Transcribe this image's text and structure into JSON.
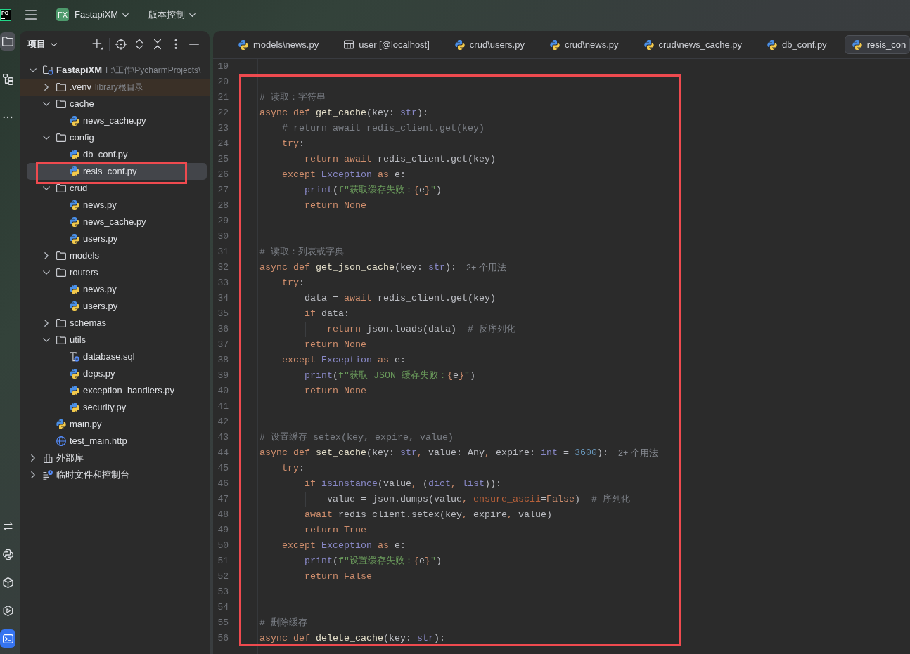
{
  "title_bar": {
    "logo_text": "PC",
    "project_badge": "FX",
    "project_name": "FastapiXM",
    "vcs_menu": "版本控制"
  },
  "tool_strip": {
    "top": [
      {
        "kind": "project",
        "selected": true
      },
      {
        "kind": "structure",
        "selected": false
      },
      {
        "kind": "more",
        "selected": false
      }
    ],
    "bottom": [
      {
        "kind": "commit",
        "selected": false
      },
      {
        "kind": "console",
        "selected": false
      },
      {
        "kind": "packages",
        "selected": false
      },
      {
        "kind": "services",
        "selected": false
      },
      {
        "kind": "terminal",
        "selected": true
      }
    ]
  },
  "project_panel": {
    "title": "项目",
    "tree": [
      {
        "label": "FastapiXM",
        "detail": "F:\\工作\\PycharmProjects\\",
        "kind": "module",
        "expanded": true,
        "selected": false,
        "boxed": false,
        "children": [
          {
            "label": ".venv",
            "detail": "library根目录",
            "kind": "excluded",
            "expanded": false,
            "selected": false,
            "boxed": false
          },
          {
            "label": "cache",
            "kind": "folder",
            "expanded": true,
            "selected": false,
            "boxed": false,
            "children": [
              {
                "label": "news_cache.py",
                "kind": "python",
                "selected": false,
                "boxed": false
              }
            ]
          },
          {
            "label": "config",
            "kind": "folder",
            "expanded": true,
            "selected": false,
            "boxed": false,
            "children": [
              {
                "label": "db_conf.py",
                "kind": "python",
                "selected": false,
                "boxed": false
              },
              {
                "label": "resis_conf.py",
                "kind": "python",
                "selected": true,
                "boxed": true
              }
            ]
          },
          {
            "label": "crud",
            "kind": "folder",
            "expanded": true,
            "selected": false,
            "boxed": false,
            "children": [
              {
                "label": "news.py",
                "kind": "python",
                "selected": false,
                "boxed": false
              },
              {
                "label": "news_cache.py",
                "kind": "python",
                "selected": false,
                "boxed": false
              },
              {
                "label": "users.py",
                "kind": "python",
                "selected": false,
                "boxed": false
              }
            ]
          },
          {
            "label": "models",
            "kind": "folder",
            "expanded": false,
            "selected": false,
            "boxed": false
          },
          {
            "label": "routers",
            "kind": "folder",
            "expanded": true,
            "selected": false,
            "boxed": false,
            "children": [
              {
                "label": "news.py",
                "kind": "python",
                "selected": false,
                "boxed": false
              },
              {
                "label": "users.py",
                "kind": "python",
                "selected": false,
                "boxed": false
              }
            ]
          },
          {
            "label": "schemas",
            "kind": "folder",
            "expanded": false,
            "selected": false,
            "boxed": false
          },
          {
            "label": "utils",
            "kind": "folder",
            "expanded": true,
            "selected": false,
            "boxed": false,
            "children": [
              {
                "label": "database.sql",
                "kind": "sql",
                "selected": false,
                "boxed": false
              },
              {
                "label": "deps.py",
                "kind": "python",
                "selected": false,
                "boxed": false
              },
              {
                "label": "exception_handlers.py",
                "kind": "python",
                "selected": false,
                "boxed": false
              },
              {
                "label": "security.py",
                "kind": "python",
                "selected": false,
                "boxed": false
              }
            ]
          },
          {
            "label": "main.py",
            "kind": "python",
            "selected": false,
            "boxed": false
          },
          {
            "label": "test_main.http",
            "kind": "http",
            "selected": false,
            "boxed": false
          }
        ]
      },
      {
        "label": "外部库",
        "kind": "library",
        "expanded": false,
        "selected": false,
        "boxed": false
      },
      {
        "label": "临时文件和控制台",
        "kind": "scratches",
        "expanded": false,
        "selected": false,
        "boxed": false
      }
    ]
  },
  "editor": {
    "tabs": [
      {
        "label": "models\\news.py",
        "kind": "python",
        "selected": false
      },
      {
        "label": "user [@localhost]",
        "kind": "table",
        "selected": false
      },
      {
        "label": "crud\\users.py",
        "kind": "python",
        "selected": false
      },
      {
        "label": "crud\\news.py",
        "kind": "python",
        "selected": false
      },
      {
        "label": "crud\\news_cache.py",
        "kind": "python",
        "selected": false
      },
      {
        "label": "db_conf.py",
        "kind": "python",
        "selected": false
      },
      {
        "label": "resis_con",
        "kind": "python",
        "selected": true
      }
    ],
    "lines": [
      {
        "number": "19"
      }
    ],
    "boxed_lines": [
      {
        "number": "20"
      },
      {
        "number": "21",
        "code": [
          {
            "text": "# 读取：字符串",
            "kind": "comment"
          }
        ]
      },
      {
        "number": "22",
        "code": [
          {
            "text": "async def ",
            "kind": "keyword"
          },
          {
            "text": "get_cache",
            "kind": "function"
          },
          {
            "text": "(key: ",
            "kind": "plain"
          },
          {
            "text": "str",
            "kind": "builtin"
          },
          {
            "text": "):",
            "kind": "plain"
          }
        ],
        "children": [
          {
            "number": "23",
            "code": [
              {
                "text": "# return await redis_client.get(key)",
                "kind": "comment"
              }
            ]
          },
          {
            "number": "24",
            "code": [
              {
                "text": "try",
                "kind": "keyword"
              },
              {
                "text": ":",
                "kind": "plain"
              }
            ],
            "children": [
              {
                "number": "25",
                "code": [
                  {
                    "text": "return await ",
                    "kind": "keyword"
                  },
                  {
                    "text": "redis_client.get(key)",
                    "kind": "plain"
                  }
                ]
              }
            ]
          },
          {
            "number": "26",
            "code": [
              {
                "text": "except ",
                "kind": "keyword"
              },
              {
                "text": "Exception",
                "kind": "builtin"
              },
              {
                "text": " as ",
                "kind": "keyword"
              },
              {
                "text": "e:",
                "kind": "plain"
              }
            ],
            "children": [
              {
                "number": "27",
                "code": [
                  {
                    "text": "print",
                    "kind": "builtin"
                  },
                  {
                    "text": "(",
                    "kind": "plain"
                  },
                  {
                    "text": "f\"获取缓存失败：",
                    "kind": "string"
                  },
                  {
                    "text": "{",
                    "kind": "brace"
                  },
                  {
                    "text": "e",
                    "kind": "plain"
                  },
                  {
                    "text": "}",
                    "kind": "brace"
                  },
                  {
                    "text": "\"",
                    "kind": "string"
                  },
                  {
                    "text": ")",
                    "kind": "plain"
                  }
                ]
              },
              {
                "number": "28",
                "code": [
                  {
                    "text": "return None",
                    "kind": "keyword"
                  }
                ]
              }
            ]
          }
        ]
      },
      {
        "number": "29"
      },
      {
        "number": "30"
      },
      {
        "number": "31",
        "code": [
          {
            "text": "# 读取：列表或字典",
            "kind": "comment"
          }
        ]
      },
      {
        "number": "32",
        "code": [
          {
            "text": "async def ",
            "kind": "keyword"
          },
          {
            "text": "get_json_cache",
            "kind": "function"
          },
          {
            "text": "(key: ",
            "kind": "plain"
          },
          {
            "text": "str",
            "kind": "builtin"
          },
          {
            "text": "):",
            "kind": "plain"
          }
        ],
        "hint": "2+ 个用法",
        "children": [
          {
            "number": "33",
            "code": [
              {
                "text": "try",
                "kind": "keyword"
              },
              {
                "text": ":",
                "kind": "plain"
              }
            ],
            "children": [
              {
                "number": "34",
                "code": [
                  {
                    "text": "data = ",
                    "kind": "plain"
                  },
                  {
                    "text": "await ",
                    "kind": "keyword"
                  },
                  {
                    "text": "redis_client.get(key)",
                    "kind": "plain"
                  }
                ]
              },
              {
                "number": "35",
                "code": [
                  {
                    "text": "if ",
                    "kind": "keyword"
                  },
                  {
                    "text": "data:",
                    "kind": "plain"
                  }
                ],
                "children": [
                  {
                    "number": "36",
                    "code": [
                      {
                        "text": "return ",
                        "kind": "keyword"
                      },
                      {
                        "text": "json.loads(data)  ",
                        "kind": "plain"
                      },
                      {
                        "text": "# 反序列化",
                        "kind": "comment"
                      }
                    ]
                  }
                ]
              },
              {
                "number": "37",
                "code": [
                  {
                    "text": "return None",
                    "kind": "keyword"
                  }
                ]
              }
            ]
          },
          {
            "number": "38",
            "code": [
              {
                "text": "except ",
                "kind": "keyword"
              },
              {
                "text": "Exception",
                "kind": "builtin"
              },
              {
                "text": " as ",
                "kind": "keyword"
              },
              {
                "text": "e:",
                "kind": "plain"
              }
            ],
            "children": [
              {
                "number": "39",
                "code": [
                  {
                    "text": "print",
                    "kind": "builtin"
                  },
                  {
                    "text": "(",
                    "kind": "plain"
                  },
                  {
                    "text": "f\"获取 JSON 缓存失败：",
                    "kind": "string"
                  },
                  {
                    "text": "{",
                    "kind": "brace"
                  },
                  {
                    "text": "e",
                    "kind": "plain"
                  },
                  {
                    "text": "}",
                    "kind": "brace"
                  },
                  {
                    "text": "\"",
                    "kind": "string"
                  },
                  {
                    "text": ")",
                    "kind": "plain"
                  }
                ]
              },
              {
                "number": "40",
                "code": [
                  {
                    "text": "return None",
                    "kind": "keyword"
                  }
                ]
              }
            ]
          }
        ]
      },
      {
        "number": "41"
      },
      {
        "number": "42"
      },
      {
        "number": "43",
        "code": [
          {
            "text": "# 设置缓存 setex(key, expire, value)",
            "kind": "comment"
          }
        ]
      },
      {
        "number": "44",
        "code": [
          {
            "text": "async def ",
            "kind": "keyword"
          },
          {
            "text": "set_cache",
            "kind": "function"
          },
          {
            "text": "(key: ",
            "kind": "plain"
          },
          {
            "text": "str",
            "kind": "builtin"
          },
          {
            "text": ", ",
            "kind": "comma"
          },
          {
            "text": "value: Any",
            "kind": "plain"
          },
          {
            "text": ", ",
            "kind": "comma"
          },
          {
            "text": "expire: ",
            "kind": "plain"
          },
          {
            "text": "int",
            "kind": "builtin"
          },
          {
            "text": " = ",
            "kind": "plain"
          },
          {
            "text": "3600",
            "kind": "number"
          },
          {
            "text": "):",
            "kind": "plain"
          }
        ],
        "hint": "2+ 个用法",
        "children": [
          {
            "number": "45",
            "code": [
              {
                "text": "try",
                "kind": "keyword"
              },
              {
                "text": ":",
                "kind": "plain"
              }
            ],
            "children": [
              {
                "number": "46",
                "code": [
                  {
                    "text": "if ",
                    "kind": "keyword"
                  },
                  {
                    "text": "isinstance",
                    "kind": "builtin"
                  },
                  {
                    "text": "(value",
                    "kind": "plain"
                  },
                  {
                    "text": ", ",
                    "kind": "comma"
                  },
                  {
                    "text": "(",
                    "kind": "plain"
                  },
                  {
                    "text": "dict",
                    "kind": "builtin"
                  },
                  {
                    "text": ", ",
                    "kind": "comma"
                  },
                  {
                    "text": "list",
                    "kind": "builtin"
                  },
                  {
                    "text": ")):",
                    "kind": "plain"
                  }
                ],
                "children": [
                  {
                    "number": "47",
                    "code": [
                      {
                        "text": "value = json.dumps(value",
                        "kind": "plain"
                      },
                      {
                        "text": ", ",
                        "kind": "comma"
                      },
                      {
                        "text": "ensure_ascii",
                        "kind": "param"
                      },
                      {
                        "text": "=",
                        "kind": "plain"
                      },
                      {
                        "text": "False",
                        "kind": "keyword"
                      },
                      {
                        "text": ")  ",
                        "kind": "plain"
                      },
                      {
                        "text": "# 序列化",
                        "kind": "comment"
                      }
                    ]
                  }
                ]
              },
              {
                "number": "48",
                "code": [
                  {
                    "text": "await ",
                    "kind": "keyword"
                  },
                  {
                    "text": "redis_client.setex(key",
                    "kind": "plain"
                  },
                  {
                    "text": ", ",
                    "kind": "comma"
                  },
                  {
                    "text": "expire",
                    "kind": "plain"
                  },
                  {
                    "text": ", ",
                    "kind": "comma"
                  },
                  {
                    "text": "value)",
                    "kind": "plain"
                  }
                ]
              },
              {
                "number": "49",
                "code": [
                  {
                    "text": "return True",
                    "kind": "keyword"
                  }
                ]
              }
            ]
          },
          {
            "number": "50",
            "code": [
              {
                "text": "except ",
                "kind": "keyword"
              },
              {
                "text": "Exception",
                "kind": "builtin"
              },
              {
                "text": " as ",
                "kind": "keyword"
              },
              {
                "text": "e:",
                "kind": "plain"
              }
            ],
            "children": [
              {
                "number": "51",
                "code": [
                  {
                    "text": "print",
                    "kind": "builtin"
                  },
                  {
                    "text": "(",
                    "kind": "plain"
                  },
                  {
                    "text": "f\"设置缓存失败：",
                    "kind": "string"
                  },
                  {
                    "text": "{",
                    "kind": "brace"
                  },
                  {
                    "text": "e",
                    "kind": "plain"
                  },
                  {
                    "text": "}",
                    "kind": "brace"
                  },
                  {
                    "text": "\"",
                    "kind": "string"
                  },
                  {
                    "text": ")",
                    "kind": "plain"
                  }
                ]
              },
              {
                "number": "52",
                "code": [
                  {
                    "text": "return False",
                    "kind": "keyword"
                  }
                ]
              }
            ]
          }
        ]
      },
      {
        "number": "53"
      },
      {
        "number": "54"
      },
      {
        "number": "55",
        "code": [
          {
            "text": "# 删除缓存",
            "kind": "comment"
          }
        ]
      },
      {
        "number": "56",
        "code": [
          {
            "text": "async def ",
            "kind": "keyword"
          },
          {
            "text": "delete_cache",
            "kind": "function"
          },
          {
            "text": "(key: ",
            "kind": "plain"
          },
          {
            "text": "str",
            "kind": "builtin"
          },
          {
            "text": "):",
            "kind": "plain"
          }
        ]
      }
    ]
  }
}
